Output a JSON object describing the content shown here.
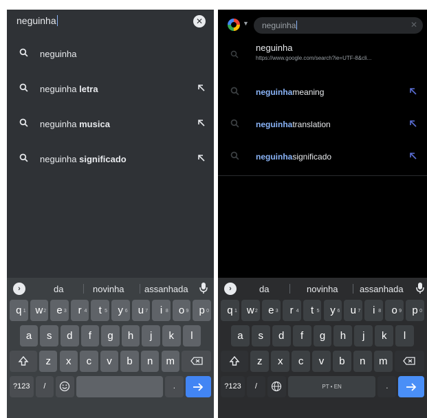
{
  "left": {
    "search_text": "neguinha",
    "clear_symbol": "✕",
    "suggestions": [
      {
        "prefix": "neguinha",
        "bold": "",
        "has_arrow": false
      },
      {
        "prefix": "neguinha ",
        "bold": "letra",
        "has_arrow": true
      },
      {
        "prefix": "neguinha ",
        "bold": "musica",
        "has_arrow": true
      },
      {
        "prefix": "neguinha ",
        "bold": "significado",
        "has_arrow": true
      }
    ],
    "keyboard_suggestions": [
      "da",
      "novinha",
      "assanhada"
    ],
    "top_row": [
      {
        "ch": "q",
        "alt": "1"
      },
      {
        "ch": "w",
        "alt": "2"
      },
      {
        "ch": "e",
        "alt": "3"
      },
      {
        "ch": "r",
        "alt": "4"
      },
      {
        "ch": "t",
        "alt": "5"
      },
      {
        "ch": "y",
        "alt": "6"
      },
      {
        "ch": "u",
        "alt": "7"
      },
      {
        "ch": "i",
        "alt": "8"
      },
      {
        "ch": "o",
        "alt": "9"
      },
      {
        "ch": "p",
        "alt": "0"
      }
    ],
    "home_row": [
      "a",
      "s",
      "d",
      "f",
      "g",
      "h",
      "j",
      "k",
      "l"
    ],
    "bottom_row": [
      "z",
      "x",
      "c",
      "v",
      "b",
      "n",
      "m"
    ],
    "symbols_key": "?123",
    "slash_key": "/",
    "period_key": "."
  },
  "right": {
    "search_text": "neguinha",
    "clear_symbol": "✕",
    "top_result": {
      "title": "neguinha",
      "url": "https://www.google.com/search?ie=UTF-8&cli..."
    },
    "suggestions": [
      {
        "highlight": "neguinha",
        "rest": "meaning"
      },
      {
        "highlight": "neguinha",
        "rest": "translation"
      },
      {
        "highlight": "neguinha",
        "rest": "significado"
      }
    ],
    "keyboard_suggestions": [
      "da",
      "novinha",
      "assanhada"
    ],
    "top_row": [
      {
        "ch": "q",
        "alt": "1"
      },
      {
        "ch": "w",
        "alt": "2"
      },
      {
        "ch": "e",
        "alt": "3"
      },
      {
        "ch": "r",
        "alt": "4"
      },
      {
        "ch": "t",
        "alt": "5"
      },
      {
        "ch": "y",
        "alt": "6"
      },
      {
        "ch": "u",
        "alt": "7"
      },
      {
        "ch": "i",
        "alt": "8"
      },
      {
        "ch": "o",
        "alt": "9"
      },
      {
        "ch": "p",
        "alt": "0"
      }
    ],
    "home_row": [
      "a",
      "s",
      "d",
      "f",
      "g",
      "h",
      "j",
      "k",
      "l"
    ],
    "bottom_row": [
      "z",
      "x",
      "c",
      "v",
      "b",
      "n",
      "m"
    ],
    "symbols_key": "?123",
    "slash_key": "/",
    "space_label": "PT • EN",
    "period_key": "."
  },
  "colors": {
    "accent": "#4285f4",
    "highlight": "#8ab4f8",
    "left_background": "#2f3236",
    "right_background": "#000000"
  }
}
